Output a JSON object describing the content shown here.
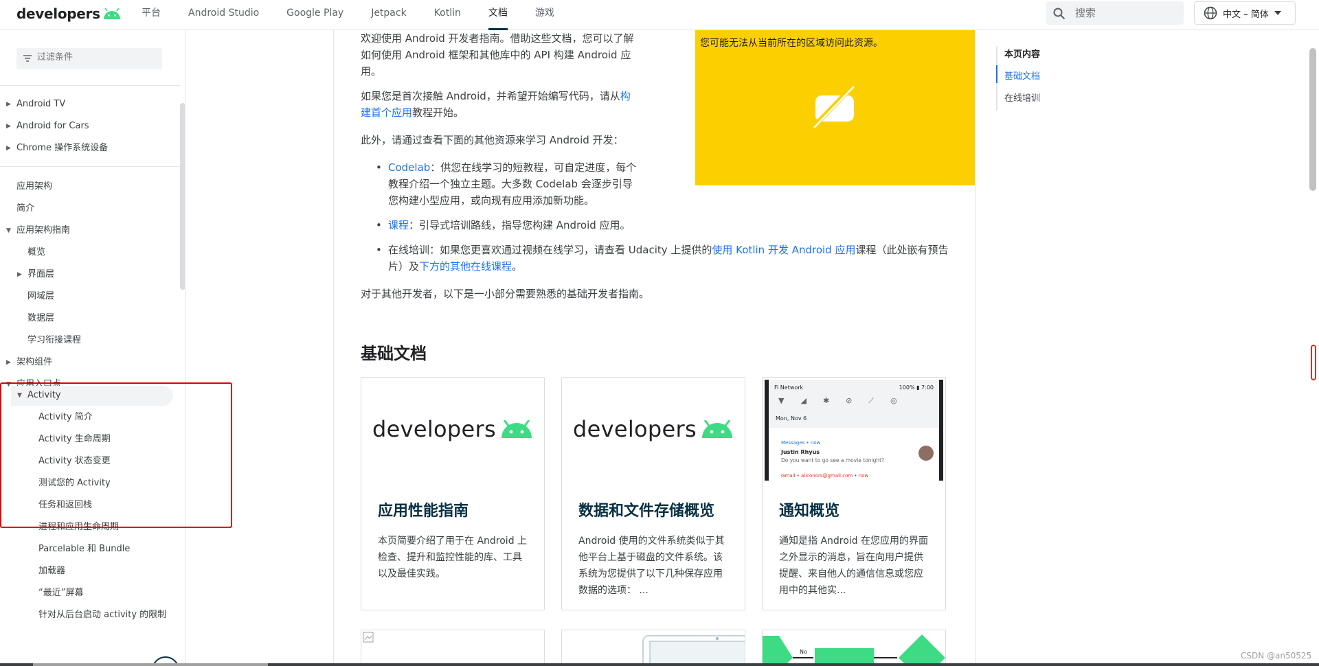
{
  "header": {
    "logo_text": "developers",
    "nav": [
      "平台",
      "Android Studio",
      "Google Play",
      "Jetpack",
      "Kotlin",
      "文档",
      "游戏"
    ],
    "active_nav": "文档",
    "search_placeholder": "搜索",
    "language": "中文 – 简体"
  },
  "sidebar": {
    "filter_placeholder": "过滤条件",
    "group1": [
      "Android TV",
      "Android for Cars",
      "Chrome 操作系统设备"
    ],
    "items": [
      {
        "label": "应用架构"
      },
      {
        "label": "简介"
      },
      {
        "label": "应用架构指南"
      },
      {
        "label": "概览"
      },
      {
        "label": "界面层"
      },
      {
        "label": "网域层"
      },
      {
        "label": "数据层"
      },
      {
        "label": "学习衔接课程"
      },
      {
        "label": "架构组件"
      },
      {
        "label": "应用入口点"
      },
      {
        "label": "Activity"
      },
      {
        "label": "Activity 简介"
      },
      {
        "label": "Activity 生命周期"
      },
      {
        "label": "Activity 状态变更"
      },
      {
        "label": "测试您的 Activity"
      },
      {
        "label": "任务和返回栈"
      },
      {
        "label": "进程和应用生命周期"
      },
      {
        "label": "Parcelable 和 Bundle"
      },
      {
        "label": "加载器"
      },
      {
        "label": "“最近”屏幕"
      },
      {
        "label": "针对从后台启动 activity 的限制"
      }
    ]
  },
  "main": {
    "intro": "欢迎使用 Android 开发者指南。借助这些文档，您可以了解如何使用 Android 框架和其他库中的 API 构建 Android 应用。",
    "first_time_pre": "如果您是首次接触 Android，并希望开始编写代码，请从",
    "first_time_link": "构建首个应用",
    "first_time_post": "教程开始。",
    "other_resources": "此外，请通过查看下面的其他资源来学习 Android 开发：",
    "bullets": {
      "codelab_link": "Codelab",
      "codelab_text": "：供您在线学习的短教程，可自定进度，每个教程介绍一个独立主题。大多数 Codelab 会逐步引导您构建小型应用，或向现有应用添加新功能。",
      "course_link": "课程",
      "course_text": "：引导式培训路线，指导您构建 Android 应用。",
      "online_pre": "在线培训：如果您更喜欢通过视频在线学习，请查看 Udacity 上提供的",
      "online_link": "使用 Kotlin 开发 Android 应用",
      "online_mid": "课程（此处嵌有预告片）及",
      "online_link2": "下方的其他在线课程",
      "online_end": "。"
    },
    "other_devs": "对于其他开发者，以下是一小部分需要熟悉的基础开发者指南。",
    "video_msg": "您可能无法从当前所在的区域访问此资源。",
    "section_title": "基础文档",
    "cards": [
      {
        "title": "应用性能指南",
        "desc": "本页简要介绍了用于在 Android 上检查、提升和监控性能的库、工具以及最佳实践。"
      },
      {
        "title": "数据和文件存储概览",
        "desc": "Android 使用的文件系统类似于其他平台上基于磁盘的文件系统。该系统为您提供了以下几种保存应用数据的选项： ..."
      },
      {
        "title": "通知概览",
        "desc": "通知是指 Android 在您应用的界面之外显示的消息，旨在向用户提供提醒、来自他人的通信信息或您应用中的其他实..."
      }
    ],
    "notif": {
      "network": "Fi Network",
      "status": "100% ▮ 7:00",
      "date": "Mon, Nov 6",
      "app": "Messages • now",
      "name": "Justin Rhyus",
      "msg": "Do you want to go see a movie tonight?",
      "gmail": "Gmail • aliconors@gmail.com • now"
    }
  },
  "toc": {
    "title": "本页内容",
    "items": [
      "基础文档",
      "在线培训"
    ]
  },
  "watermark": "CSDN @an50525"
}
